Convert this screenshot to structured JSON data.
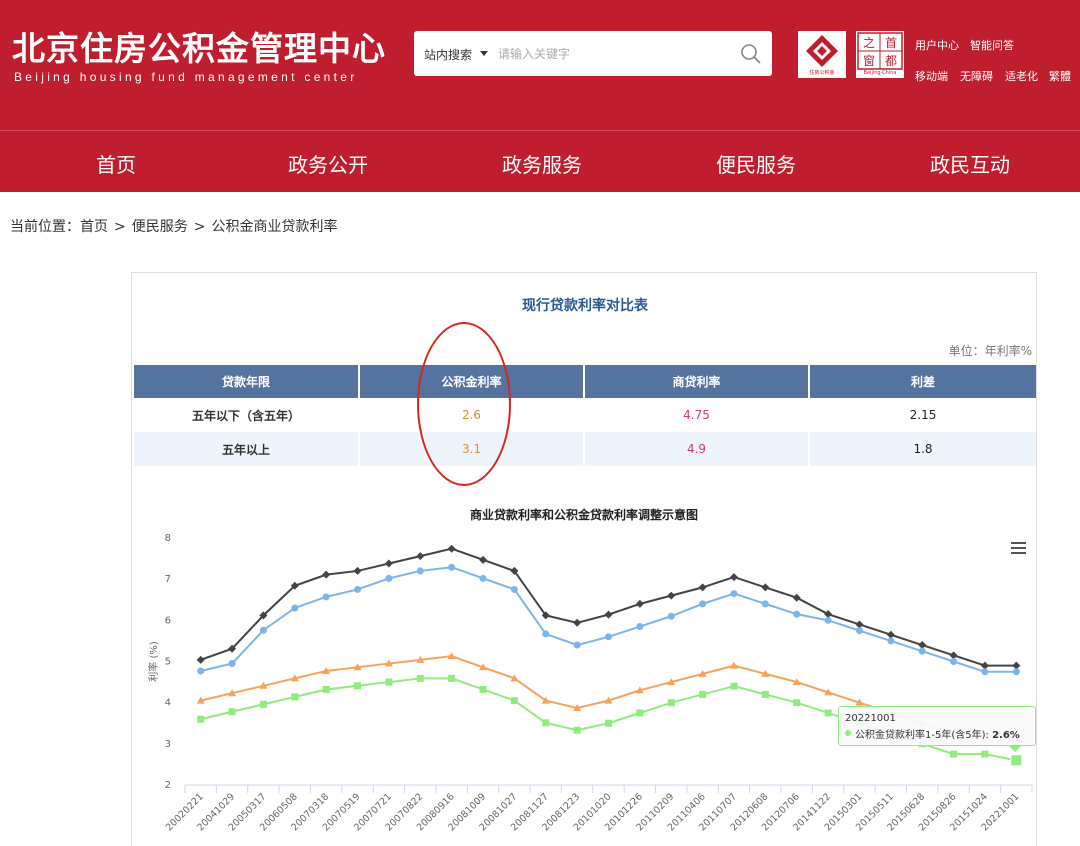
{
  "site": {
    "title": "北京住房公积金管理中心",
    "subtitle": "Beijing housing fund management center",
    "search_scope": "站内搜索",
    "search_placeholder": "请输入关键字",
    "badge_caption": "住房公积金",
    "badge2_chars": [
      "之",
      "首",
      "窗",
      "都"
    ],
    "badge2_caption": "Beijing·China",
    "links_row1": [
      "用户中心",
      "智能问答"
    ],
    "links_row2": [
      "移动端",
      "无障碍",
      "适老化",
      "繁體"
    ],
    "brand_color": "#bf1e2e"
  },
  "nav": [
    "首页",
    "政务公开",
    "政务服务",
    "便民服务",
    "政民互动"
  ],
  "breadcrumb": {
    "prefix": "当前位置：",
    "items": [
      "首页",
      "便民服务",
      "公积金商业贷款利率"
    ],
    "sep": ">"
  },
  "rate_table": {
    "title": "现行贷款利率对比表",
    "unit": "单位：年利率%",
    "headers": [
      "贷款年限",
      "公积金利率",
      "商贷利率",
      "利差"
    ],
    "rows": [
      [
        "五年以下（含五年）",
        "2.6",
        "4.75",
        "2.15"
      ],
      [
        "五年以上",
        "3.1",
        "4.9",
        "1.8"
      ]
    ]
  },
  "chart_data": {
    "type": "line",
    "title": "商业贷款利率和公积金贷款利率调整示意图",
    "ylabel": "利率 (%)",
    "ylim": [
      2,
      8
    ],
    "yticks": [
      2,
      3,
      4,
      5,
      6,
      7,
      8
    ],
    "x": [
      "20020221",
      "20041029",
      "20050317",
      "20060508",
      "20070318",
      "20070519",
      "20070721",
      "20070822",
      "20080916",
      "20081009",
      "20081027",
      "20081127",
      "20081223",
      "20101020",
      "20101226",
      "20110209",
      "20110406",
      "20110707",
      "20120608",
      "20120706",
      "20141122",
      "20150301",
      "20150511",
      "20150628",
      "20150826",
      "20151024",
      "20221001"
    ],
    "series": [
      {
        "color": "#434348",
        "marker": "diamond",
        "values": [
          5.04,
          5.31,
          6.12,
          6.84,
          7.11,
          7.2,
          7.38,
          7.56,
          7.74,
          7.47,
          7.2,
          6.12,
          5.94,
          6.14,
          6.4,
          6.6,
          6.8,
          7.05,
          6.8,
          6.55,
          6.15,
          5.9,
          5.65,
          5.4,
          5.15,
          4.9,
          4.9
        ]
      },
      {
        "color": "#7cb5ec",
        "marker": "circle",
        "values": [
          4.77,
          4.95,
          5.76,
          6.3,
          6.57,
          6.75,
          7.02,
          7.2,
          7.29,
          7.02,
          6.75,
          5.67,
          5.4,
          5.6,
          5.85,
          6.1,
          6.4,
          6.65,
          6.4,
          6.15,
          6.0,
          5.75,
          5.5,
          5.25,
          5.0,
          4.75,
          4.75
        ]
      },
      {
        "color": "#f7a35c",
        "marker": "triangle",
        "values": [
          4.05,
          4.23,
          4.41,
          4.59,
          4.77,
          4.86,
          4.95,
          5.04,
          5.13,
          4.86,
          4.59,
          4.05,
          3.87,
          4.05,
          4.3,
          4.5,
          4.7,
          4.9,
          4.7,
          4.5,
          4.25,
          4.0,
          3.75,
          3.5,
          3.25,
          3.25,
          3.1
        ]
      },
      {
        "name": "公积金贷款利率1-5年(含5年)",
        "color": "#90ed7d",
        "marker": "square",
        "values": [
          3.6,
          3.78,
          3.96,
          4.14,
          4.32,
          4.41,
          4.5,
          4.59,
          4.59,
          4.32,
          4.05,
          3.51,
          3.33,
          3.5,
          3.75,
          4.0,
          4.2,
          4.4,
          4.2,
          4.0,
          3.75,
          3.5,
          3.25,
          3.0,
          2.75,
          2.75,
          2.6
        ]
      }
    ],
    "tooltip": {
      "date": "20221001",
      "label": "公积金贷款利率1-5年(含5年):",
      "value": "2.6%"
    },
    "grid": false
  }
}
